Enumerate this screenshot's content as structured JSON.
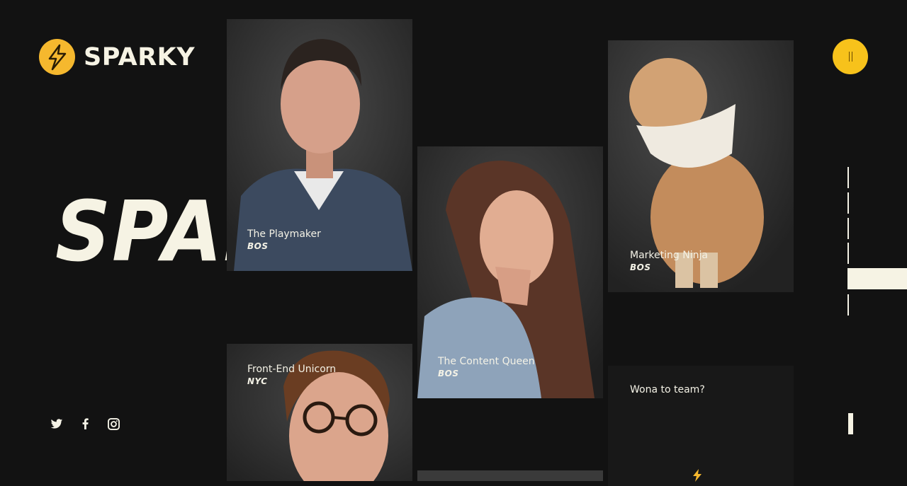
{
  "brand": {
    "name": "SPARKY",
    "accent": "#f5b82e"
  },
  "hero": {
    "title": "SPARKY"
  },
  "team": [
    {
      "role": "The Playmaker",
      "city": "BOS"
    },
    {
      "role": "The Content Queen",
      "city": "BOS"
    },
    {
      "role": "Marketing Ninja",
      "city": "BOS"
    },
    {
      "role": "Front-End Unicorn",
      "city": "NYC"
    }
  ],
  "join": {
    "title": "Wona to team?"
  },
  "icons": {
    "menu": "pause-menu-icon",
    "twitter": "twitter-icon",
    "facebook": "facebook-icon",
    "instagram": "instagram-icon",
    "bolt": "lightning-bolt-icon"
  },
  "colors": {
    "background": "#121212",
    "text": "#f4f2e6",
    "menu": "#f7c21b"
  }
}
